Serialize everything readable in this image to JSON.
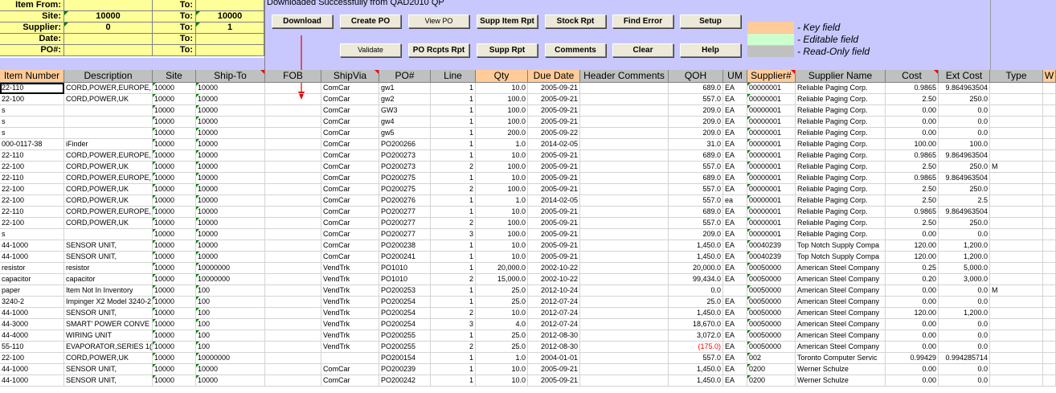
{
  "filter": {
    "item_from_label": "Item From:",
    "to1_label": "To:",
    "site_label": "Site:",
    "site_from": "10000",
    "to2_label": "To:",
    "site_to": "10000",
    "supplier_label": "Supplier:",
    "supplier_from": "0",
    "to3_label": "To:",
    "supplier_to": "1",
    "date_label": "Date:",
    "to4_label": "To:",
    "po_label": "PO#:",
    "to5_label": "To:"
  },
  "status": "Downloaded Successfully from QAD2010 QP",
  "buttons": {
    "download": "Download",
    "create_po": "Create PO",
    "view_po": "View PO",
    "supp_item_rpt": "Supp Item Rpt",
    "stock_rpt": "Stock Rpt",
    "find_error": "Find Error",
    "setup": "Setup",
    "validate": "Validate",
    "po_rcpts_rpt": "PO Rcpts Rpt",
    "supp_rpt": "Supp Rpt",
    "comments": "Comments",
    "clear": "Clear",
    "help": "Help"
  },
  "legend": {
    "key": "- Key field",
    "editable": "- Editable field",
    "readonly": "- Read-Only field",
    "key_color": "#ffcc99",
    "editable_color": "#ccffcc",
    "readonly_color": "#c0c0c0"
  },
  "columns": [
    "Item Number",
    "Description",
    "Site",
    "Ship-To",
    "FOB",
    "ShipVia",
    "PO#",
    "Line",
    "Qty",
    "Due Date",
    "Header Comments",
    "QOH",
    "UM",
    "Supplier#",
    "Supplier Name",
    "Cost",
    "Ext Cost",
    "Type",
    "W"
  ],
  "rows": [
    [
      "22-110",
      "CORD,POWER,EUROPE,",
      "10000",
      "10000",
      "",
      "ComCar",
      "gw1",
      "1",
      "10.0",
      "2005-09-21",
      "",
      "689.0",
      "EA",
      "00000001",
      "Reliable Paging Corp.",
      "0.9865",
      "9.864963504",
      ""
    ],
    [
      "22-100",
      "CORD,POWER,UK",
      "10000",
      "10000",
      "",
      "ComCar",
      "gw2",
      "1",
      "100.0",
      "2005-09-21",
      "",
      "557.0",
      "EA",
      "00000001",
      "Reliable Paging Corp.",
      "2.50",
      "250.0",
      ""
    ],
    [
      "s",
      "",
      "10000",
      "10000",
      "",
      "ComCar",
      "GW3",
      "1",
      "100.0",
      "2005-09-21",
      "",
      "209.0",
      "EA",
      "00000001",
      "Reliable Paging Corp.",
      "0.00",
      "0.0",
      ""
    ],
    [
      "s",
      "",
      "10000",
      "10000",
      "",
      "ComCar",
      "gw4",
      "1",
      "100.0",
      "2005-09-21",
      "",
      "209.0",
      "EA",
      "00000001",
      "Reliable Paging Corp.",
      "0.00",
      "0.0",
      ""
    ],
    [
      "s",
      "",
      "10000",
      "10000",
      "",
      "ComCar",
      "gw5",
      "1",
      "200.0",
      "2005-09-22",
      "",
      "209.0",
      "EA",
      "00000001",
      "Reliable Paging Corp.",
      "0.00",
      "0.0",
      ""
    ],
    [
      "000-0117-38",
      "iFinder",
      "10000",
      "10000",
      "",
      "ComCar",
      "PO200266",
      "1",
      "1.0",
      "2014-02-05",
      "",
      "31.0",
      "EA",
      "00000001",
      "Reliable Paging Corp.",
      "100.00",
      "100.0",
      ""
    ],
    [
      "22-110",
      "CORD,POWER,EUROPE,",
      "10000",
      "10000",
      "",
      "ComCar",
      "PO200273",
      "1",
      "10.0",
      "2005-09-21",
      "",
      "689.0",
      "EA",
      "00000001",
      "Reliable Paging Corp.",
      "0.9865",
      "9.864963504",
      ""
    ],
    [
      "22-100",
      "CORD,POWER,UK",
      "10000",
      "10000",
      "",
      "ComCar",
      "PO200273",
      "2",
      "100.0",
      "2005-09-21",
      "",
      "557.0",
      "EA",
      "00000001",
      "Reliable Paging Corp.",
      "2.50",
      "250.0",
      "M"
    ],
    [
      "22-110",
      "CORD,POWER,EUROPE,",
      "10000",
      "10000",
      "",
      "ComCar",
      "PO200275",
      "1",
      "10.0",
      "2005-09-21",
      "",
      "689.0",
      "EA",
      "00000001",
      "Reliable Paging Corp.",
      "0.9865",
      "9.864963504",
      ""
    ],
    [
      "22-100",
      "CORD,POWER,UK",
      "10000",
      "10000",
      "",
      "ComCar",
      "PO200275",
      "2",
      "100.0",
      "2005-09-21",
      "",
      "557.0",
      "EA",
      "00000001",
      "Reliable Paging Corp.",
      "2.50",
      "250.0",
      ""
    ],
    [
      "22-100",
      "CORD,POWER,UK",
      "10000",
      "10000",
      "",
      "ComCar",
      "PO200276",
      "1",
      "1.0",
      "2014-02-05",
      "",
      "557.0",
      "ea",
      "00000001",
      "Reliable Paging Corp.",
      "2.50",
      "2.5",
      ""
    ],
    [
      "22-110",
      "CORD,POWER,EUROPE,",
      "10000",
      "10000",
      "",
      "ComCar",
      "PO200277",
      "1",
      "10.0",
      "2005-09-21",
      "",
      "689.0",
      "EA",
      "00000001",
      "Reliable Paging Corp.",
      "0.9865",
      "9.864963504",
      ""
    ],
    [
      "22-100",
      "CORD,POWER,UK",
      "10000",
      "10000",
      "",
      "ComCar",
      "PO200277",
      "2",
      "100.0",
      "2005-09-21",
      "",
      "557.0",
      "EA",
      "00000001",
      "Reliable Paging Corp.",
      "2.50",
      "250.0",
      ""
    ],
    [
      "s",
      "",
      "10000",
      "10000",
      "",
      "ComCar",
      "PO200277",
      "3",
      "100.0",
      "2005-09-21",
      "",
      "209.0",
      "EA",
      "00000001",
      "Reliable Paging Corp.",
      "0.00",
      "0.0",
      ""
    ],
    [
      "44-1000",
      "SENSOR UNIT,",
      "10000",
      "10000",
      "",
      "ComCar",
      "PO200238",
      "1",
      "10.0",
      "2005-09-21",
      "",
      "1,450.0",
      "EA",
      "00040239",
      "Top Notch Supply Compa",
      "120.00",
      "1,200.0",
      ""
    ],
    [
      "44-1000",
      "SENSOR UNIT,",
      "10000",
      "10000",
      "",
      "ComCar",
      "PO200241",
      "1",
      "10.0",
      "2005-09-21",
      "",
      "1,450.0",
      "EA",
      "00040239",
      "Top Notch Supply Compa",
      "120.00",
      "1,200.0",
      ""
    ],
    [
      "resistor",
      "resistor",
      "10000",
      "10000000",
      "",
      "VendTrk",
      "PO1010",
      "1",
      "20,000.0",
      "2002-10-22",
      "",
      "20,000.0",
      "EA",
      "00050000",
      "American Steel Company",
      "0.25",
      "5,000.0",
      ""
    ],
    [
      "capacitor",
      "capacitor",
      "10000",
      "10000000",
      "",
      "VendTrk",
      "PO1010",
      "2",
      "15,000.0",
      "2002-10-22",
      "",
      "99,434.0",
      "EA",
      "00050000",
      "American Steel Company",
      "0.20",
      "3,000.0",
      ""
    ],
    [
      "paper",
      "Item Not In Inventory",
      "10000",
      "100",
      "",
      "VendTrk",
      "PO200253",
      "1",
      "25.0",
      "2012-10-24",
      "",
      "0.0",
      "",
      "00050000",
      "American Steel Company",
      "0.00",
      "0.0",
      "M"
    ],
    [
      "3240-2",
      "Impinger X2 Model 3240-2",
      "10000",
      "100",
      "",
      "VendTrk",
      "PO200254",
      "1",
      "25.0",
      "2012-07-24",
      "",
      "25.0",
      "EA",
      "00050000",
      "American Steel Company",
      "0.00",
      "0.0",
      ""
    ],
    [
      "44-1000",
      "SENSOR UNIT,",
      "10000",
      "100",
      "",
      "VendTrk",
      "PO200254",
      "2",
      "10.0",
      "2012-07-24",
      "",
      "1,450.0",
      "EA",
      "00050000",
      "American Steel Company",
      "120.00",
      "1,200.0",
      ""
    ],
    [
      "44-3000",
      "SMART' POWER CONVE",
      "10000",
      "100",
      "",
      "VendTrk",
      "PO200254",
      "3",
      "4.0",
      "2012-07-24",
      "",
      "18,670.0",
      "EA",
      "00050000",
      "American Steel Company",
      "0.00",
      "0.0",
      ""
    ],
    [
      "44-4000",
      "WIRING UNIT",
      "10000",
      "100",
      "",
      "VendTrk",
      "PO200255",
      "1",
      "25.0",
      "2012-08-30",
      "",
      "3,072.0",
      "EA",
      "00050000",
      "American Steel Company",
      "0.00",
      "0.0",
      ""
    ],
    [
      "55-110",
      "EVAPORATOR,SERIES 1(",
      "10000",
      "100",
      "",
      "VendTrk",
      "PO200255",
      "2",
      "25.0",
      "2012-08-30",
      "",
      "(175.0)",
      "EA",
      "00050000",
      "American Steel Company",
      "0.00",
      "0.0",
      ""
    ],
    [
      "22-100",
      "CORD,POWER,UK",
      "10000",
      "10000000",
      "",
      "",
      "PO200154",
      "1",
      "1.0",
      "2004-01-01",
      "",
      "557.0",
      "EA",
      "002",
      "Toronto Computer Servic",
      "0.99429",
      "0.994285714",
      ""
    ],
    [
      "44-1000",
      "SENSOR UNIT,",
      "10000",
      "10000",
      "",
      "ComCar",
      "PO200239",
      "1",
      "10.0",
      "2005-09-21",
      "",
      "1,450.0",
      "EA",
      "0200",
      "Werner Schulze",
      "0.00",
      "0.0",
      ""
    ],
    [
      "44-1000",
      "SENSOR UNIT,",
      "10000",
      "10000",
      "",
      "ComCar",
      "PO200242",
      "1",
      "10.0",
      "2005-09-21",
      "",
      "1,450.0",
      "EA",
      "0200",
      "Werner Schulze",
      "0.00",
      "0.0",
      ""
    ]
  ]
}
